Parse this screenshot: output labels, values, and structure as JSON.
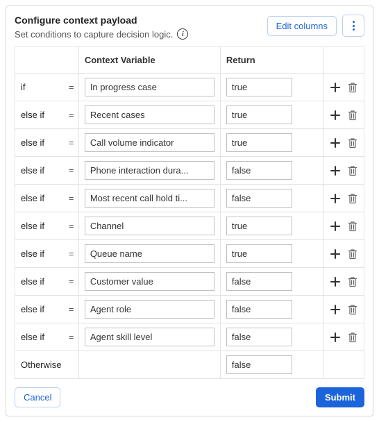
{
  "header": {
    "title": "Configure context payload",
    "subtitle": "Set conditions to capture decision logic.",
    "edit_columns_label": "Edit columns"
  },
  "columns": {
    "condition": "",
    "variable": "Context Variable",
    "return": "Return"
  },
  "eq_symbol": "=",
  "rows": [
    {
      "condition": "if",
      "variable": "In progress case",
      "return": "true"
    },
    {
      "condition": "else if",
      "variable": "Recent cases",
      "return": "true"
    },
    {
      "condition": "else if",
      "variable": "Call volume indicator",
      "return": "true"
    },
    {
      "condition": "else if",
      "variable": "Phone interaction dura...",
      "return": "false"
    },
    {
      "condition": "else if",
      "variable": "Most recent call hold ti...",
      "return": "false"
    },
    {
      "condition": "else if",
      "variable": "Channel",
      "return": "true"
    },
    {
      "condition": "else if",
      "variable": "Queue name",
      "return": "true"
    },
    {
      "condition": "else if",
      "variable": "Customer value",
      "return": "false"
    },
    {
      "condition": "else if",
      "variable": "Agent role",
      "return": "false"
    },
    {
      "condition": "else if",
      "variable": "Agent skill level",
      "return": "false"
    }
  ],
  "otherwise": {
    "condition": "Otherwise",
    "return": "false"
  },
  "footer": {
    "cancel": "Cancel",
    "submit": "Submit"
  }
}
